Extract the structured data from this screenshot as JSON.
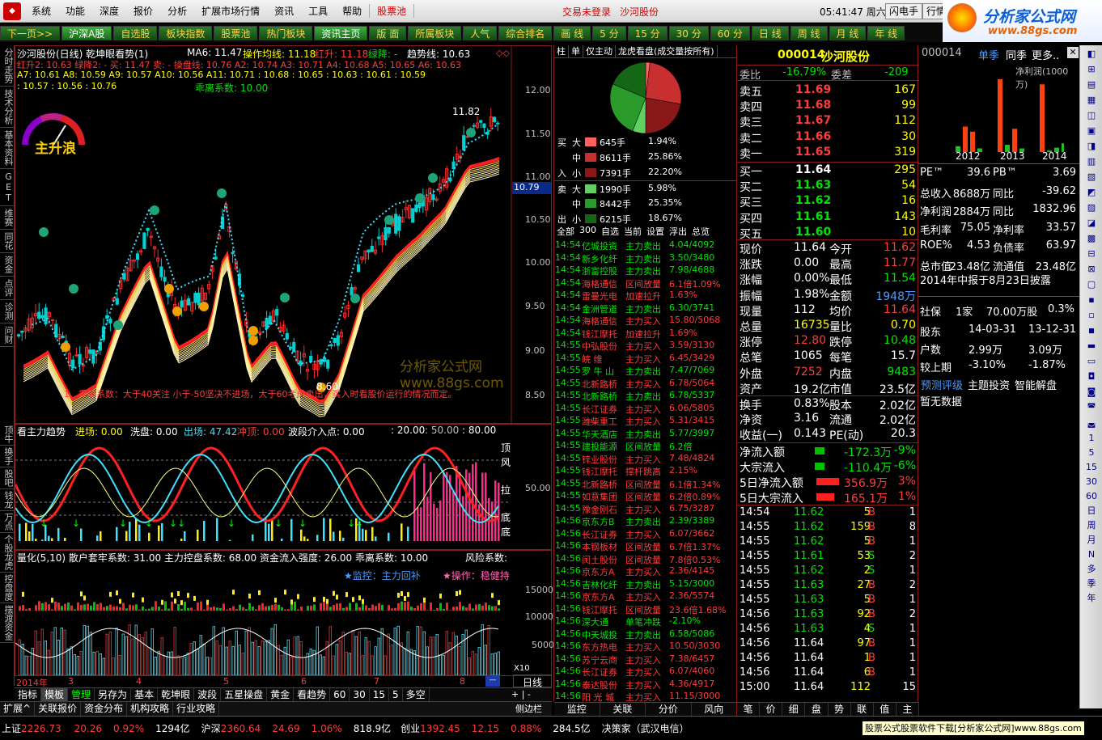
{
  "menu": {
    "items": [
      "系统",
      "功能",
      "深度",
      "报价",
      "分析",
      "扩展市场行情",
      "资讯",
      "工具",
      "帮助"
    ],
    "pool": "股票池",
    "login": "交易未登录",
    "stock": "沙河股份",
    "time": "05:41:47 周六",
    "btn1": "闪电手",
    "btn2": "行情",
    "logo": "分析家公式网",
    "logo_url": "www.88gs.com"
  },
  "tabs": [
    "下一页>>",
    "沪深A股",
    "自选股",
    "板块指数",
    "股票池",
    "热门板块",
    "资讯主页",
    "版 面",
    "所属板块",
    "人气",
    "综合排名",
    "画 线",
    "5 分",
    "15 分",
    "30 分",
    "60 分",
    "日 线",
    "周 线",
    "月 线",
    "年 线"
  ],
  "left_tabs": [
    "分时走势",
    "技术分析",
    "基本资料",
    "GET",
    "维赛",
    "同花",
    "资金",
    "点评",
    "诊测",
    "问财"
  ],
  "chart": {
    "title": "沙河股份(日线) 乾坤眼看势(1)",
    "ma6": "MA6: 11.47",
    "op_line": "操作均线: 11.18",
    "red_up": "红升: 11.18",
    "green_down": "绿降: -",
    "trend_line": "趋势线: 10.63",
    "line2": "红升2: 10.63  绿降2: -  买: 11.47  卖: -  操盘线: 10.76  A2: 10.74  A3: 10.71  A4: 10.68  A5: 10.65  A6: 10.63",
    "line3": "A7: 10.61  A8: 10.59  A9: 10.57  A10: 10.56  A11: 10.71  : 10.68  : 10.65  : 10.63  : 10.61  : 10.59",
    "line4": ": 10.57  : 10.56  : 10.76",
    "deviation": "乖离系数: 10.00",
    "gauge_label": "主升浪",
    "high_mark": "11.82",
    "low_mark": "8.60",
    "price_label": "10.79",
    "note": "1、乖离系数：大于40关注 小于-50坚决不进场，大于60考虑卖出，买入时看股价运行的情况而定。",
    "watermark": "分析家公式网  www.88gs.com",
    "yaxis": [
      "12.00",
      "11.50",
      "11.00",
      "10.50",
      "10.00",
      "9.50",
      "9.00",
      "8.50"
    ],
    "sub1_title": "看主力趋势",
    "sub1_vals": [
      "进场: 0.00",
      "洗盘: 0.00",
      "出场: 47.42",
      "冲顶: 0.00",
      "波段介入点: 0.00",
      ": 20.00",
      ": 50.00",
      ": 80.00"
    ],
    "sub1_tags": [
      "顶",
      "风",
      "拉",
      "底",
      "底"
    ],
    "sub1_y": "50.00",
    "sub2_title": "量化(5,10)  散户套牢系数: 31.00  主力控盘系数: 68.00  资金流入强度: 26.00  乖离系数: 10.00",
    "sub2_risk": "风险系数:",
    "sub2_monitor": "★监控：主力回补",
    "sub2_op": "★操作：稳健持",
    "sub2_y": [
      "15000",
      "10000",
      "5000"
    ],
    "sub2_x10": "X10",
    "years": [
      "2014年",
      "3",
      "4",
      "5",
      "6",
      "7",
      "8"
    ],
    "left_side_tabs": [
      "顶牛",
      "换手",
      "股吧",
      "钱龙",
      "万点",
      "个股龙虎",
      "控盘度",
      "摆渡资金"
    ],
    "bottom_tabs": [
      "指标",
      "模板",
      "管理",
      "另存为",
      "基本",
      "乾坤眼",
      "波段",
      "五星操盘",
      "黄金",
      "看趋势",
      "60",
      "30",
      "15",
      "5",
      "多空"
    ],
    "bottom_tabs2": [
      "扩展^",
      "关联报价",
      "资金分布",
      "机构攻略",
      "行业攻略"
    ],
    "period": "日线"
  },
  "mid": {
    "tabs": [
      "柱",
      "单",
      "仅主动",
      "龙虎看盘(成交量按所有)"
    ],
    "pie": [
      {
        "label": "买大",
        "pct": 1.94,
        "color": "#ff6060"
      },
      {
        "label": "买中",
        "pct": 25.86,
        "color": "#c83030"
      },
      {
        "label": "买小",
        "pct": 22.2,
        "color": "#8a1818"
      },
      {
        "label": "卖大",
        "pct": 5.98,
        "color": "#60d060"
      },
      {
        "label": "卖中",
        "pct": 25.35,
        "color": "#2a9a2a"
      },
      {
        "label": "卖小",
        "pct": 18.67,
        "color": "#156615"
      }
    ],
    "flow": [
      {
        "side": "买",
        "size": "大",
        "vol": "645手",
        "pct": "1.94%",
        "color": "#ff6060"
      },
      {
        "side": "",
        "size": "中",
        "vol": "8611手",
        "pct": "25.86%",
        "color": "#c83030"
      },
      {
        "side": "入",
        "size": "小",
        "vol": "7391手",
        "pct": "22.20%",
        "color": "#8a1818"
      },
      {
        "side": "卖",
        "size": "大",
        "vol": "1990手",
        "pct": "5.98%",
        "color": "#60d060"
      },
      {
        "side": "",
        "size": "中",
        "vol": "8442手",
        "pct": "25.35%",
        "color": "#2a9a2a"
      },
      {
        "side": "出",
        "size": "小",
        "vol": "6215手",
        "pct": "18.67%",
        "color": "#156615"
      }
    ],
    "filters": [
      "全部",
      "300",
      "自选",
      "当前",
      "设置",
      "浮出",
      "总览"
    ],
    "news": [
      [
        "14:54",
        "亿城投资",
        "主力卖出",
        "4.04/4092",
        "g"
      ],
      [
        "14:54",
        "新乡化纤",
        "主力卖出",
        "3.50/3480",
        "g"
      ],
      [
        "14:54",
        "浙富控股",
        "主力卖出",
        "7.98/4688",
        "g"
      ],
      [
        "14:54",
        "海格通信",
        "区间放量",
        "6.1倍1.09%",
        "r"
      ],
      [
        "14:54",
        "雷曼光电",
        "加速拉升",
        "1.63%",
        "r"
      ],
      [
        "14:54",
        "金洲管道",
        "主力卖出",
        "6.30/3741",
        "g"
      ],
      [
        "14:54",
        "海格通信",
        "主力买入",
        "15.80/5068",
        "r"
      ],
      [
        "14:54",
        "钱江摩托",
        "加速拉升",
        "1.69%",
        "r"
      ],
      [
        "14:55",
        "中弘股份",
        "主力买入",
        "3.59/3130",
        "r"
      ],
      [
        "14:55",
        "皖 维",
        "主力买入",
        "6.45/3429",
        "r"
      ],
      [
        "14:55",
        "罗 牛 山",
        "主力卖出",
        "7.47/7069",
        "g"
      ],
      [
        "14:55",
        "北新路桥",
        "主力买入",
        "6.78/5064",
        "r"
      ],
      [
        "14:55",
        "北新路桥",
        "主力卖出",
        "6.78/5337",
        "g"
      ],
      [
        "14:55",
        "长江证券",
        "主力买入",
        "6.06/5805",
        "r"
      ],
      [
        "14:55",
        "潍柴重工",
        "主力买入",
        "5.31/3415",
        "r"
      ],
      [
        "14:55",
        "华天酒店",
        "主力卖出",
        "5.77/3997",
        "g"
      ],
      [
        "14:55",
        "建投能源",
        "区间放量",
        "6.2倍",
        "g"
      ],
      [
        "14:55",
        "锌业股份",
        "主力买入",
        "7.48/4824",
        "r"
      ],
      [
        "14:55",
        "钱江摩托",
        "撑杆跳高",
        "2.15%",
        "r"
      ],
      [
        "14:55",
        "北新路桥",
        "区间放量",
        "6.1倍1.34%",
        "r"
      ],
      [
        "14:55",
        "如意集团",
        "区间放量",
        "6.2倍0.89%",
        "r"
      ],
      [
        "14:55",
        "豫金刚石",
        "主力买入",
        "6.75/3287",
        "r"
      ],
      [
        "14:56",
        "京东方B",
        "主力卖出",
        "2.39/3389",
        "g"
      ],
      [
        "14:56",
        "长江证券",
        "主力买入",
        "6.07/3662",
        "r"
      ],
      [
        "14:56",
        "本钢板材",
        "区间放量",
        "6.7倍1.37%",
        "r"
      ],
      [
        "14:56",
        "闰土股份",
        "区间放量",
        "7.8倍0.53%",
        "r"
      ],
      [
        "14:56",
        "京东方A",
        "主力买入",
        "2.36/4145",
        "r"
      ],
      [
        "14:56",
        "吉林化纤",
        "主力卖出",
        "5.15/3000",
        "g"
      ],
      [
        "14:56",
        "京东方A",
        "主力买入",
        "2.36/5574",
        "r"
      ],
      [
        "14:56",
        "钱江摩托",
        "区间放量",
        "23.6倍1.68%",
        "r"
      ],
      [
        "14:56",
        "深大通",
        "单笔冲跌",
        "-2.10%",
        "g"
      ],
      [
        "14:56",
        "中天城投",
        "主力卖出",
        "6.58/5086",
        "g"
      ],
      [
        "14:56",
        "东方热电",
        "主力买入",
        "10.50/3030",
        "r"
      ],
      [
        "14:56",
        "苏宁云商",
        "主力买入",
        "7.38/6457",
        "r"
      ],
      [
        "14:56",
        "长江证券",
        "主力买入",
        "6.07/4060",
        "r"
      ],
      [
        "14:56",
        "泰达股份",
        "主力买入",
        "4.36/4917",
        "r"
      ],
      [
        "14:56",
        "阳 光 城",
        "主力买入",
        "11.15/3000",
        "r"
      ]
    ],
    "bottom_tabs": [
      "监控",
      "关联",
      "分价",
      "风向"
    ]
  },
  "quote": {
    "code": "000014",
    "name": "沙河股份",
    "wb_label": "委比",
    "wb": "-16.79%",
    "wc_label": "委差",
    "wc": "-209",
    "sells": [
      [
        "卖五",
        "11.69",
        "167"
      ],
      [
        "卖四",
        "11.68",
        "99"
      ],
      [
        "卖三",
        "11.67",
        "112"
      ],
      [
        "卖二",
        "11.66",
        "30"
      ],
      [
        "卖一",
        "11.65",
        "319"
      ]
    ],
    "buys": [
      [
        "买一",
        "11.64",
        "295"
      ],
      [
        "买二",
        "11.63",
        "54"
      ],
      [
        "买三",
        "11.62",
        "16"
      ],
      [
        "买四",
        "11.61",
        "143"
      ],
      [
        "买五",
        "11.60",
        "10"
      ]
    ],
    "stats": [
      [
        "现价",
        "11.64",
        "今开",
        "11.62"
      ],
      [
        "涨跌",
        "0.00",
        "最高",
        "11.77"
      ],
      [
        "涨幅",
        "0.00%",
        "最低",
        "11.54"
      ],
      [
        "振幅",
        "1.98%",
        "金额",
        "1948万"
      ],
      [
        "现量",
        "112",
        "均价",
        "11.64"
      ],
      [
        "总量",
        "16735",
        "量比",
        "0.70"
      ],
      [
        "涨停",
        "12.80",
        "跌停",
        "10.48"
      ],
      [
        "总笔",
        "1065",
        "每笔",
        "15.7"
      ],
      [
        "外盘",
        "7252",
        "内盘",
        "9483"
      ],
      [
        "资产",
        "19.2亿",
        "市值",
        "23.5亿"
      ],
      [
        "换手",
        "0.83%",
        "股本",
        "2.02亿"
      ],
      [
        "净资",
        "3.16",
        "流通",
        "2.02亿"
      ],
      [
        "收益(一)",
        "0.143",
        "PE(动)",
        "20.3"
      ]
    ],
    "flows": [
      [
        "净流入额",
        "-172.3万",
        "-9%"
      ],
      [
        "大宗流入",
        "-110.4万",
        "-6%"
      ],
      [
        "5日净流入额",
        "356.9万",
        "3%"
      ],
      [
        "5日大宗流入",
        "165.1万",
        "1%"
      ]
    ],
    "ticks": [
      [
        "14:54",
        "11.62",
        "5",
        "B",
        "1"
      ],
      [
        "14:55",
        "11.62",
        "159",
        "B",
        "8"
      ],
      [
        "14:55",
        "11.62",
        "5",
        "B",
        "1"
      ],
      [
        "14:55",
        "11.61",
        "53",
        "S",
        "2"
      ],
      [
        "14:55",
        "11.62",
        "2",
        "S",
        "1"
      ],
      [
        "14:55",
        "11.63",
        "27",
        "B",
        "2"
      ],
      [
        "14:55",
        "11.63",
        "5",
        "B",
        "1"
      ],
      [
        "14:56",
        "11.63",
        "92",
        "B",
        "2"
      ],
      [
        "14:56",
        "11.63",
        "4",
        "S",
        "1"
      ],
      [
        "14:56",
        "11.64",
        "97",
        "B",
        "1"
      ],
      [
        "14:56",
        "11.64",
        "1",
        "B",
        "1"
      ],
      [
        "14:56",
        "11.64",
        "6",
        "B",
        "1"
      ],
      [
        "15:00",
        "11.64",
        "112",
        "",
        "15"
      ]
    ],
    "bottom_tabs": [
      "笔",
      "价",
      "细",
      "盘",
      "势",
      "联",
      "值",
      "主"
    ]
  },
  "fin": {
    "code": "000014",
    "tabs": [
      "单季",
      "同季",
      "更多.."
    ],
    "chart_title": "净利润(1000万)",
    "years": [
      "2012",
      "2013",
      "2014"
    ],
    "bars": [
      0.08,
      0.35,
      0.28,
      0.05,
      1.0,
      0.1,
      0.32,
      0.05,
      0.93,
      0.02,
      0.06,
      0.12
    ],
    "rows": [
      [
        "PE™",
        "39.6",
        "PB™",
        "3.69"
      ],
      [
        "总收入",
        "8688万",
        "同比",
        "-39.62"
      ],
      [
        "净利润",
        "2884万",
        "同比",
        "1832.96"
      ],
      [
        "毛利率",
        "75.05",
        "净利率",
        "33.57"
      ],
      [
        "ROE%",
        "4.53",
        "负债率",
        "63.97"
      ],
      [
        "总市值",
        "23.48亿",
        "流通值",
        "23.48亿"
      ]
    ],
    "report": "2014年中报于8月23日披露",
    "holder": [
      "社保",
      "1家",
      "70.00万股",
      "0.3%"
    ],
    "dates": [
      "股东",
      "14-03-31",
      "13-12-31"
    ],
    "hu": [
      "户数",
      "2.99万",
      "3.09万"
    ],
    "last": [
      "较上期",
      "-3.10%",
      "-1.87%"
    ],
    "links": [
      "预测评级",
      "主题投资",
      "智能解盘"
    ],
    "no_data": "暂无数据"
  },
  "rightbar": [
    "1",
    "5",
    "15",
    "30",
    "60",
    "日",
    "周",
    "月",
    "N",
    "多",
    "季",
    "年"
  ],
  "status": {
    "sh_label": "上证",
    "sh": "2226.73",
    "sh_chg": "20.26",
    "sh_pct": "0.92%",
    "sh_amt": "1294亿",
    "hs_label": "沪深",
    "hs": "2360.64",
    "hs_chg": "24.69",
    "hs_pct": "1.06%",
    "hs_amt": "818.9亿",
    "cy_label": "创业",
    "cy": "1392.45",
    "cy_chg": "12.15",
    "cy_pct": "0.88%",
    "cy_amt": "284.5亿",
    "broker": "决策家（武汉电信）",
    "ad": "股票公式股票软件下载[分析家公式网]www.88gs.com"
  }
}
